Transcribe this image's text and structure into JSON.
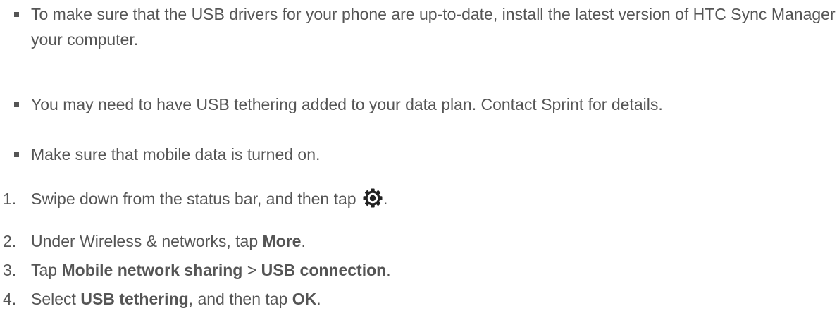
{
  "notes": [
    "To make sure that the USB drivers for your phone are up-to-date, install the latest version of HTC Sync Manager on your computer.",
    "You may need to have USB tethering added to your data plan. Contact Sprint for details.",
    "Make sure that mobile data is turned on."
  ],
  "steps": [
    {
      "number": "1.",
      "text_before": "Swipe down from the status bar, and then tap",
      "icon": "settings-gear-icon",
      "text_after": "."
    },
    {
      "number": "2.",
      "text_before": "Under Wireless & networks, tap ",
      "bold1": "More",
      "text_after": "."
    },
    {
      "number": "3.",
      "text_before": "Tap ",
      "bold1": "Mobile network sharing",
      "separator": " > ",
      "bold2": "USB connection",
      "text_after": "."
    },
    {
      "number": "4.",
      "text_before": "Select ",
      "bold1": "USB tethering",
      "middle": ", and then tap ",
      "bold2": "OK",
      "text_after": "."
    }
  ],
  "colors": {
    "text": "#555555",
    "background": "#ffffff"
  }
}
